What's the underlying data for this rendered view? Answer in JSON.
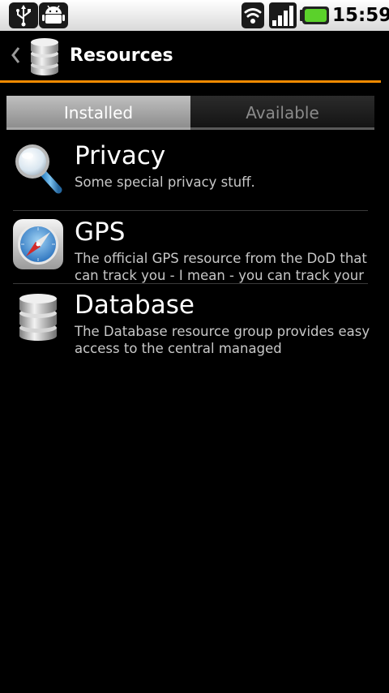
{
  "statusbar": {
    "icons": [
      "usb-icon",
      "android-debug-icon",
      "wifi-icon",
      "signal-icon",
      "battery-icon"
    ],
    "clock": "15:59",
    "battery_color": "#5bd12b"
  },
  "titlebar": {
    "title": "Resources",
    "accent_color": "#f08a00"
  },
  "tabs": [
    {
      "label": "Installed",
      "selected": true
    },
    {
      "label": "Available",
      "selected": false
    }
  ],
  "items": [
    {
      "title": "Privacy",
      "icon": "magnifier-icon",
      "description": "Some special privacy stuff."
    },
    {
      "title": "GPS",
      "icon": "compass-icon",
      "description": "The official GPS resource from the DoD that can track you - I mean - you can track your"
    },
    {
      "title": "Database",
      "icon": "database-icon",
      "description": "The Database resource group provides easy access to the central managed"
    }
  ]
}
